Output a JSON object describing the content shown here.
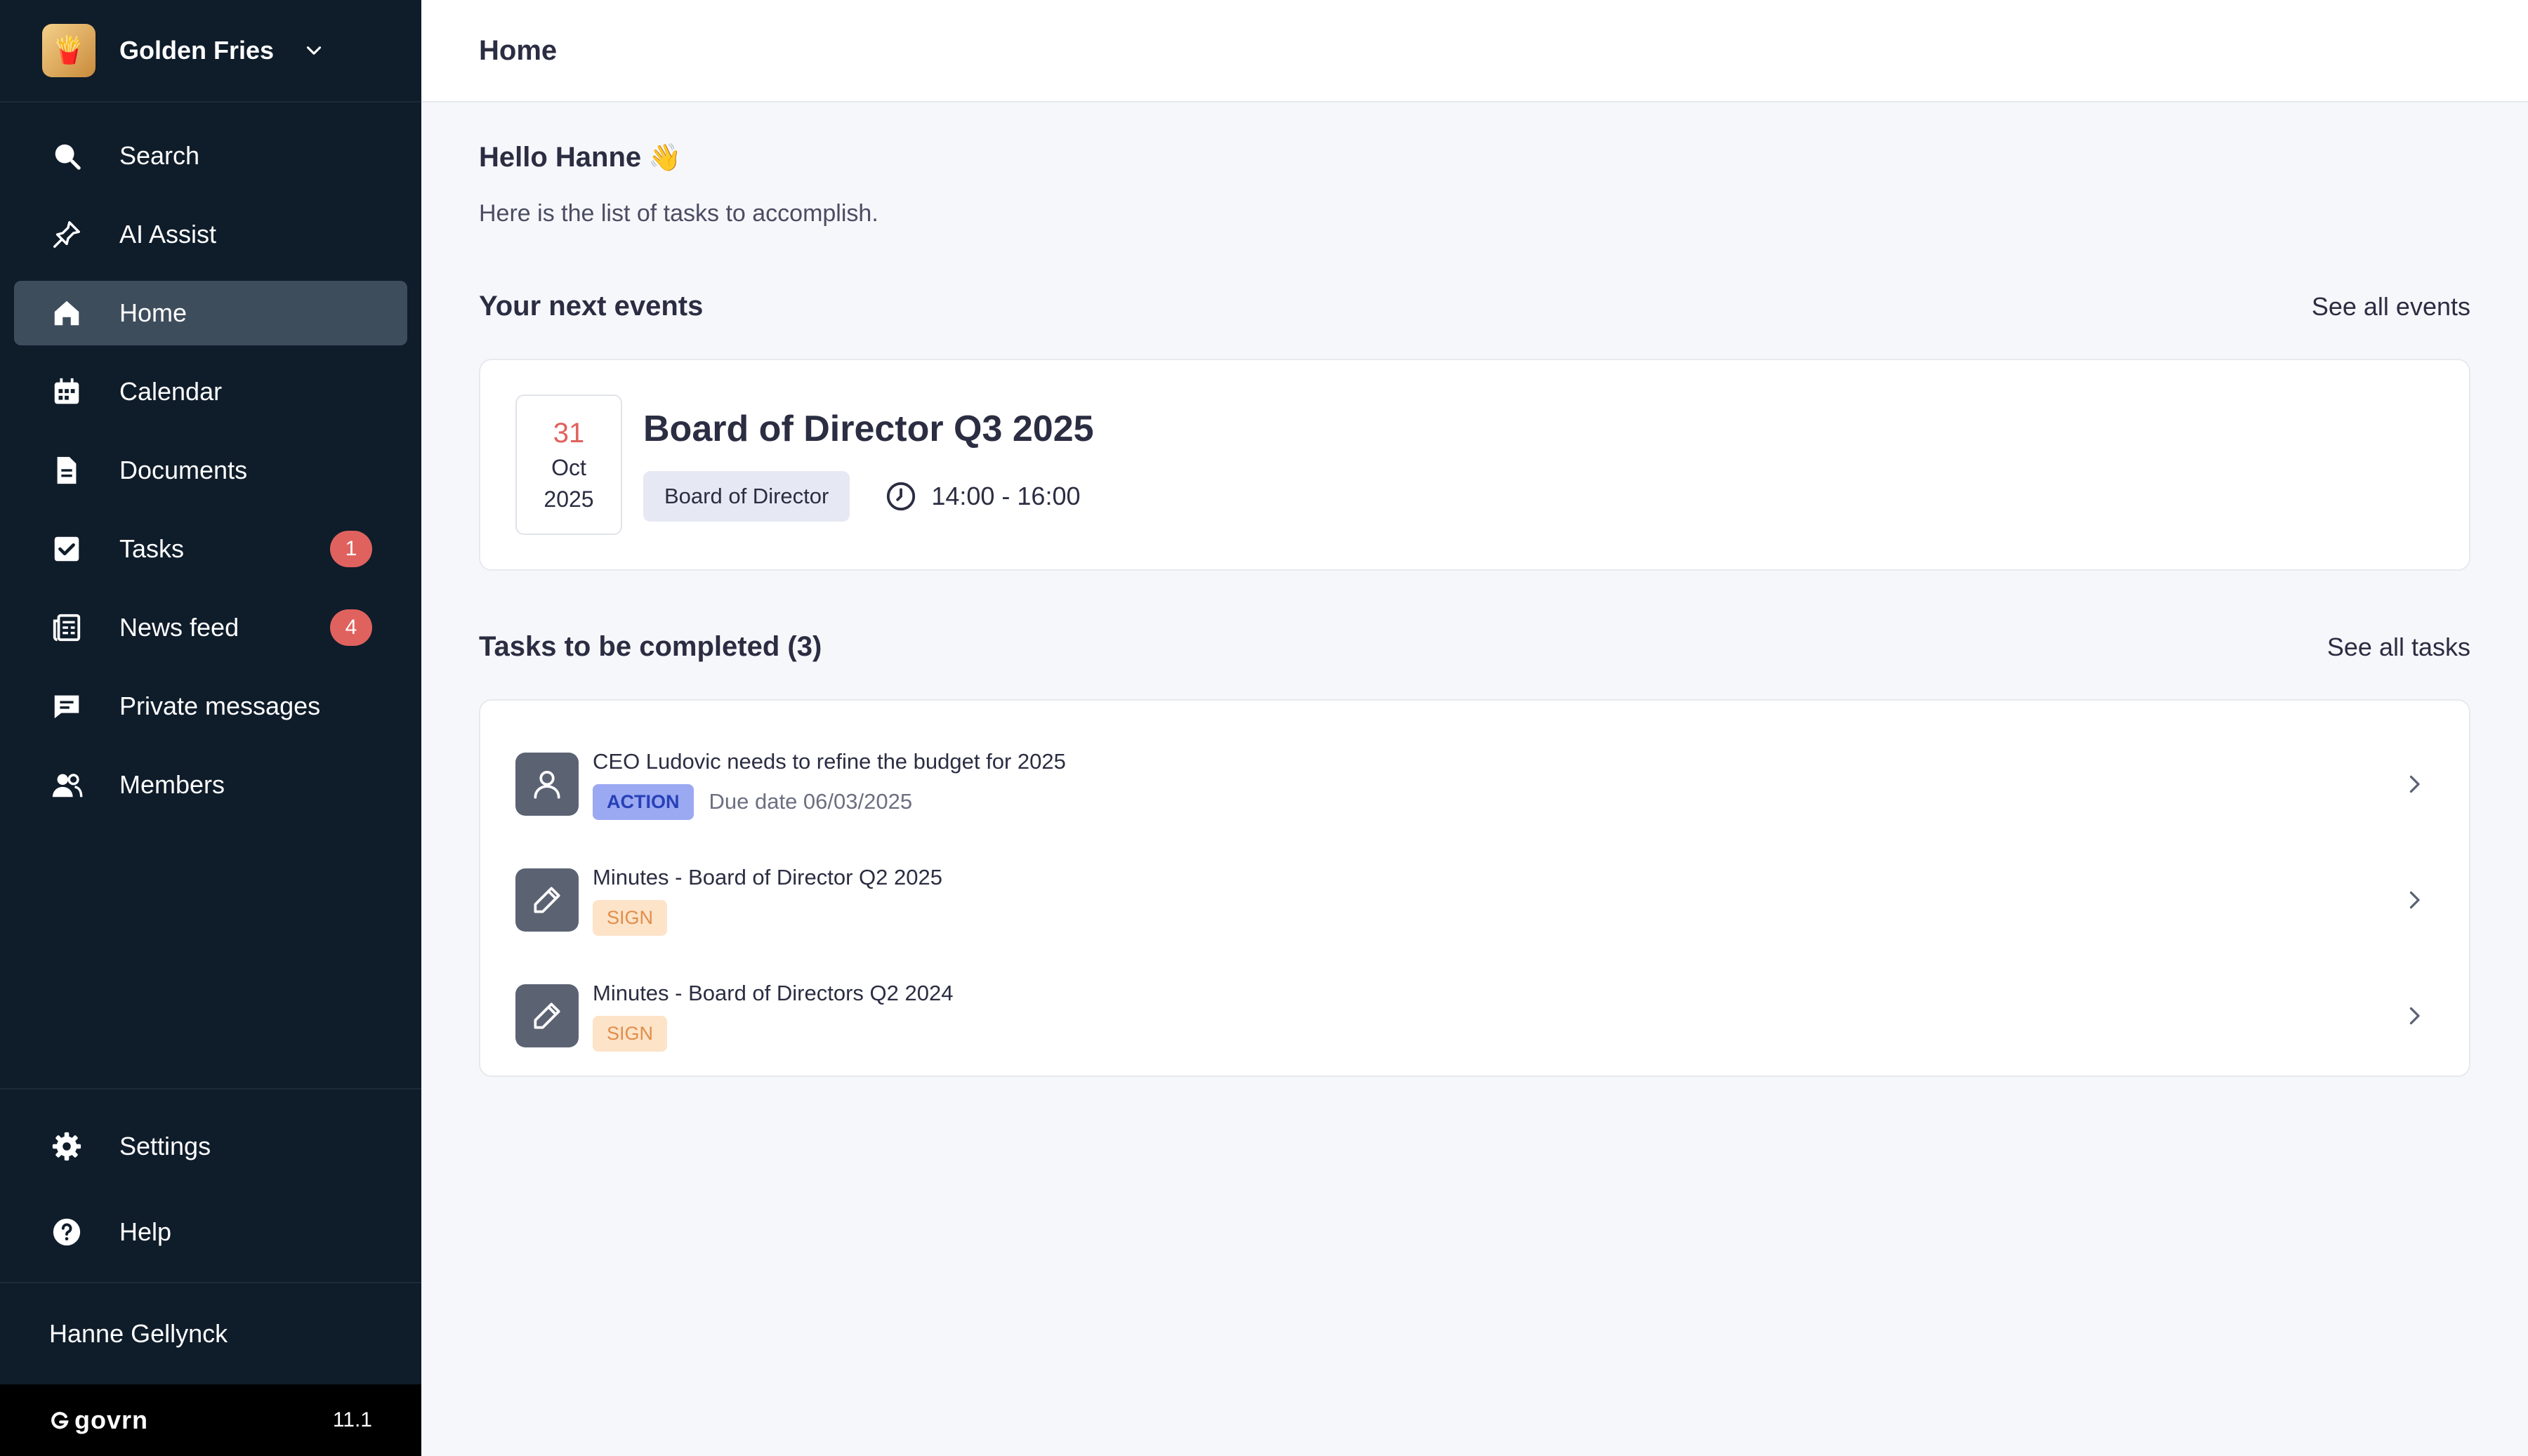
{
  "org": {
    "name": "Golden Fries",
    "logo_icon": "crest-icon"
  },
  "nav": {
    "items": [
      {
        "label": "Search",
        "icon": "search-icon"
      },
      {
        "label": "AI Assist",
        "icon": "ai-assist-icon"
      },
      {
        "label": "Home",
        "icon": "home-icon",
        "active": true
      },
      {
        "label": "Calendar",
        "icon": "calendar-icon"
      },
      {
        "label": "Documents",
        "icon": "document-icon"
      },
      {
        "label": "Tasks",
        "icon": "checkbox-icon",
        "badge": "1"
      },
      {
        "label": "News feed",
        "icon": "newspaper-icon",
        "badge": "4"
      },
      {
        "label": "Private messages",
        "icon": "message-icon"
      },
      {
        "label": "Members",
        "icon": "members-icon"
      }
    ],
    "bottom": [
      {
        "label": "Settings",
        "icon": "gear-icon"
      },
      {
        "label": "Help",
        "icon": "help-icon"
      }
    ]
  },
  "user": {
    "name": "Hanne Gellynck"
  },
  "footer": {
    "brand": "govrn",
    "version": "11.1"
  },
  "header": {
    "title": "Home"
  },
  "greeting": {
    "hello": "Hello Hanne",
    "emoji": "👋",
    "subtitle": "Here is the list of tasks to accomplish."
  },
  "events": {
    "title": "Your next events",
    "see_all": "See all events",
    "items": [
      {
        "day": "31",
        "month": "Oct",
        "year": "2025",
        "title": "Board of Director Q3 2025",
        "tag": "Board of Director",
        "time": "14:00 - 16:00"
      }
    ]
  },
  "tasks": {
    "title": "Tasks to be completed (3)",
    "see_all": "See all tasks",
    "items": [
      {
        "icon": "user-icon",
        "title": "CEO Ludovic needs to refine the budget for 2025",
        "tag": "ACTION",
        "due": "Due date 06/03/2025"
      },
      {
        "icon": "pencil-icon",
        "title": "Minutes - Board of Director Q2 2025",
        "tag": "SIGN"
      },
      {
        "icon": "pencil-icon",
        "title": "Minutes - Board of Directors Q2 2024",
        "tag": "SIGN"
      }
    ]
  },
  "colors": {
    "sidebar": "#0f1c2a",
    "active": "#3e4d5c",
    "badge": "#e0625e",
    "action_tag": "#9ba9f2",
    "sign_tag": "#fde3c8"
  }
}
